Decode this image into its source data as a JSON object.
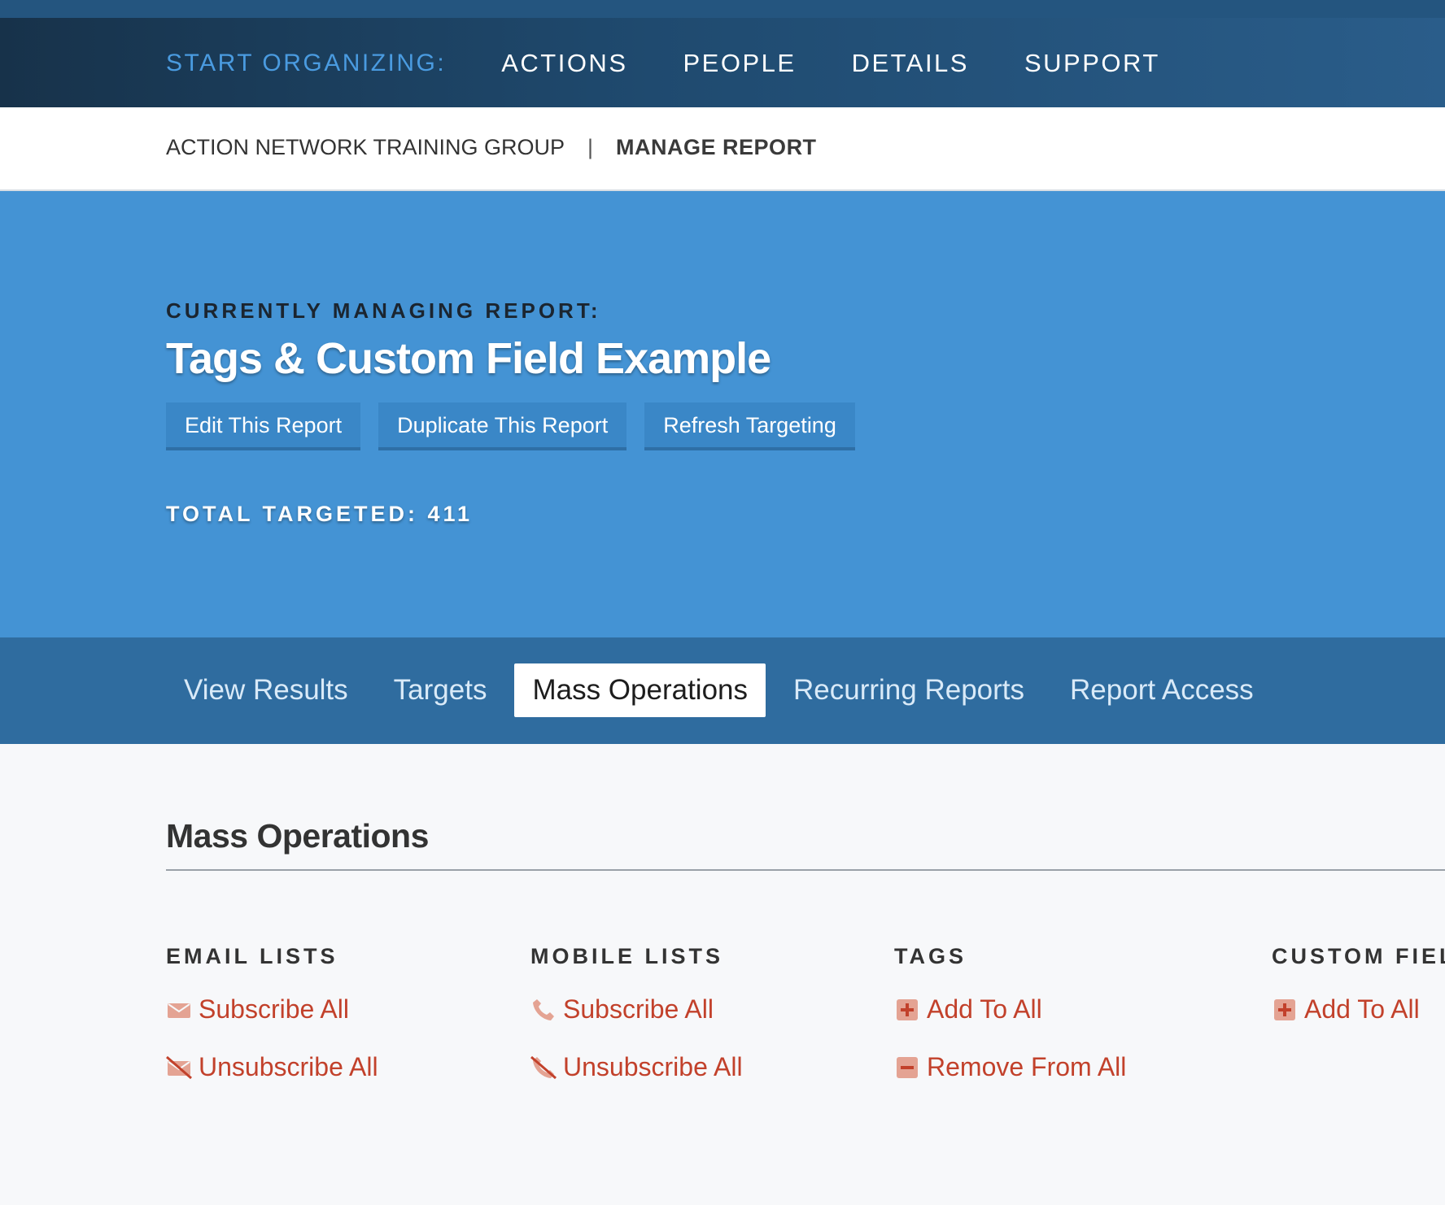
{
  "topnav": {
    "lead": "START ORGANIZING:",
    "links": [
      "ACTIONS",
      "PEOPLE",
      "DETAILS",
      "SUPPORT"
    ]
  },
  "breadcrumb": {
    "group": "ACTION NETWORK TRAINING GROUP",
    "separator": "|",
    "current": "MANAGE REPORT"
  },
  "hero": {
    "label": "CURRENTLY MANAGING REPORT:",
    "title": "Tags & Custom Field Example",
    "buttons": [
      "Edit This Report",
      "Duplicate This Report",
      "Refresh Targeting"
    ],
    "total": "TOTAL TARGETED: 411"
  },
  "tabs": [
    "View Results",
    "Targets",
    "Mass Operations",
    "Recurring Reports",
    "Report Access"
  ],
  "content": {
    "heading": "Mass Operations",
    "columns": [
      {
        "title": "EMAIL LISTS",
        "ops": [
          "Subscribe All",
          "Unsubscribe All"
        ]
      },
      {
        "title": "MOBILE LISTS",
        "ops": [
          "Subscribe All",
          "Unsubscribe All"
        ]
      },
      {
        "title": "TAGS",
        "ops": [
          "Add To All",
          "Remove From All"
        ]
      },
      {
        "title": "CUSTOM FIEL",
        "ops": [
          "Add To All"
        ]
      }
    ]
  },
  "colors": {
    "accent_link": "#c2412b",
    "hero_blue": "#4493d4",
    "tabbar_blue": "#2f6c9f",
    "lead_blue": "#4a9be0"
  },
  "icons": {
    "email_subscribe": "envelope-icon",
    "email_unsubscribe": "envelope-slash-icon",
    "mobile_subscribe": "phone-icon",
    "mobile_unsubscribe": "phone-slash-icon",
    "tag_add": "plus-square-icon",
    "tag_remove": "minus-square-icon"
  }
}
